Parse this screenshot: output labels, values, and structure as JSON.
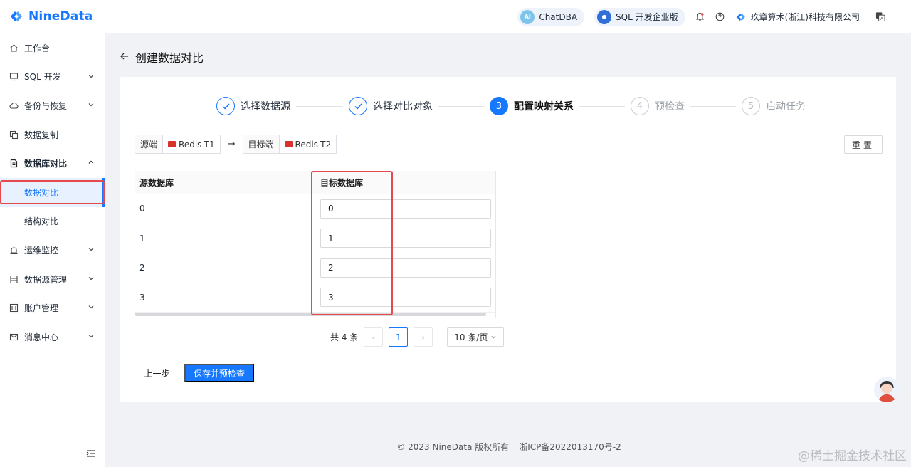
{
  "topbar": {
    "logo_text": "NineData",
    "chatdba_label": "ChatDBA",
    "sql_edition_label": "SQL 开发企业版",
    "org_name": "玖章算术(浙江)科技有限公司"
  },
  "sidebar": {
    "items": [
      {
        "label": "工作台"
      },
      {
        "label": "SQL 开发"
      },
      {
        "label": "备份与恢复"
      },
      {
        "label": "数据复制"
      },
      {
        "label": "数据库对比"
      },
      {
        "label": "数据对比"
      },
      {
        "label": "结构对比"
      },
      {
        "label": "运维监控"
      },
      {
        "label": "数据源管理"
      },
      {
        "label": "账户管理"
      },
      {
        "label": "消息中心"
      }
    ]
  },
  "page": {
    "title": "创建数据对比"
  },
  "steps": [
    {
      "num": "",
      "label": "选择数据源"
    },
    {
      "num": "",
      "label": "选择对比对象"
    },
    {
      "num": "3",
      "label": "配置映射关系"
    },
    {
      "num": "4",
      "label": "预检查"
    },
    {
      "num": "5",
      "label": "启动任务"
    }
  ],
  "source": {
    "src_label": "源端",
    "src_value": "Redis-T1",
    "dst_label": "目标端",
    "dst_value": "Redis-T2",
    "reset_label": "重置"
  },
  "table": {
    "headers": [
      "源数据库",
      "目标数据库"
    ],
    "rows": [
      {
        "source": "0",
        "target": "0"
      },
      {
        "source": "1",
        "target": "1"
      },
      {
        "source": "2",
        "target": "2"
      },
      {
        "source": "3",
        "target": "3"
      }
    ]
  },
  "pagination": {
    "total": "共 4 条",
    "current": "1",
    "page_size": "10 条/页"
  },
  "actions": {
    "prev_label": "上一步",
    "save_label": "保存并预检查"
  },
  "footer": {
    "copyright": "© 2023 NineData 版权所有",
    "icp": "浙ICP备2022013170号-2"
  },
  "watermark": "@稀土掘金技术社区",
  "colors": {
    "accent": "#1677ff",
    "highlight_box": "#e5484d",
    "redis": "#d7322b"
  }
}
